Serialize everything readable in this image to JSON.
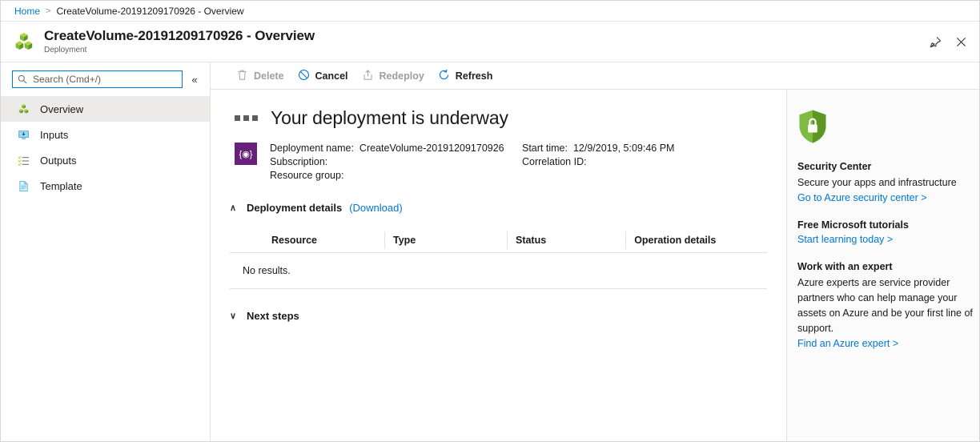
{
  "breadcrumb": {
    "home": "Home",
    "separator": ">",
    "current": "CreateVolume-20191209170926 - Overview"
  },
  "header": {
    "title": "CreateVolume-20191209170926 - Overview",
    "subtitle": "Deployment",
    "pin_label": "Pin",
    "close_label": "Close"
  },
  "sidebar": {
    "search": {
      "placeholder": "Search (Cmd+/)",
      "value": ""
    },
    "collapse_label": "«",
    "items": [
      {
        "label": "Overview",
        "icon": "deployment-cubes-icon",
        "selected": true
      },
      {
        "label": "Inputs",
        "icon": "inputs-monitor-icon",
        "selected": false
      },
      {
        "label": "Outputs",
        "icon": "outputs-list-icon",
        "selected": false
      },
      {
        "label": "Template",
        "icon": "template-document-icon",
        "selected": false
      }
    ]
  },
  "toolbar": {
    "buttons": [
      {
        "label": "Delete",
        "icon": "trash-icon",
        "disabled": true
      },
      {
        "label": "Cancel",
        "icon": "cancel-circle-icon",
        "disabled": false
      },
      {
        "label": "Redeploy",
        "icon": "upload-box-icon",
        "disabled": true
      },
      {
        "label": "Refresh",
        "icon": "refresh-circle-icon",
        "disabled": false
      }
    ]
  },
  "main": {
    "headline": "Your deployment is underway",
    "status_icon": "in-progress-dots-icon",
    "deployment_badge_icon": "arm-template-icon",
    "fields_left": [
      {
        "label": "Deployment name:",
        "value": "CreateVolume-20191209170926"
      },
      {
        "label": "Subscription:",
        "value": ""
      },
      {
        "label": "Resource group:",
        "value": ""
      }
    ],
    "fields_right": [
      {
        "label": "Start time:",
        "value": "12/9/2019, 5:09:46 PM"
      },
      {
        "label": "Correlation ID:",
        "value": ""
      }
    ],
    "details_section": {
      "title": "Deployment details",
      "download_label": "(Download)",
      "expanded": true,
      "chevron": "∧"
    },
    "table": {
      "columns": [
        "Resource",
        "Type",
        "Status",
        "Operation details"
      ],
      "rows": [],
      "empty_text": "No results."
    },
    "next_steps": {
      "title": "Next steps",
      "expanded": false,
      "chevron": "∨"
    }
  },
  "right_rail": {
    "blocks": [
      {
        "icon": "security-shield-lock-icon",
        "title": "Security Center",
        "text": "Secure your apps and infrastructure",
        "link": "Go to Azure security center >"
      },
      {
        "title": "Free Microsoft tutorials",
        "text": "",
        "link": "Start learning today >"
      },
      {
        "title": "Work with an expert",
        "text": "Azure experts are service provider partners who can help manage your assets on Azure and be your first line of support.",
        "link": "Find an Azure expert >"
      }
    ]
  },
  "colors": {
    "accent": "#0078d4",
    "purple_badge": "#68217a",
    "green_icon": "#7fba42",
    "selected_nav": "#edebe9"
  }
}
